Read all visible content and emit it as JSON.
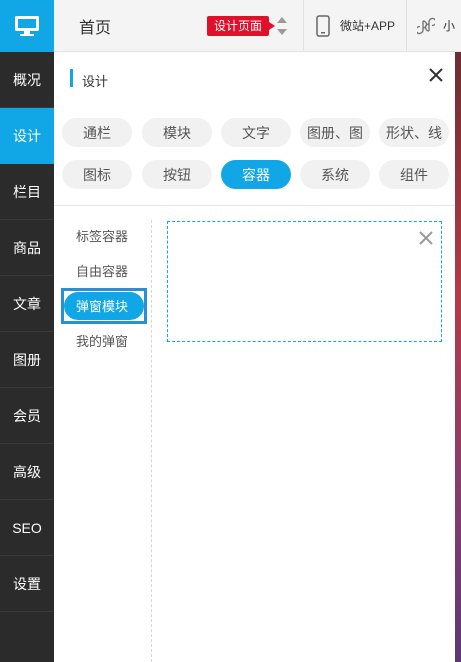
{
  "sidebar": {
    "logo_icon": "monitor-icon",
    "items": [
      {
        "label": "概况"
      },
      {
        "label": "设计",
        "active": true
      },
      {
        "label": "栏目"
      },
      {
        "label": "商品"
      },
      {
        "label": "文章"
      },
      {
        "label": "图册"
      },
      {
        "label": "会员"
      },
      {
        "label": "高级"
      },
      {
        "label": "SEO"
      },
      {
        "label": "设置"
      }
    ]
  },
  "topbar": {
    "home_label": "首页",
    "page_badge": "设计页面",
    "app_label": "微站+APP",
    "mini_label": "小",
    "icons": [
      "phone-icon",
      "mini-program-icon",
      "sort-arrows-icon"
    ]
  },
  "panel": {
    "title": "设计",
    "tabs": [
      "通栏",
      "模块",
      "文字",
      "图册、图",
      "形状、线",
      "图标",
      "按钮",
      "容器",
      "系统",
      "组件"
    ],
    "active_tab": "容器",
    "sub_items": [
      "标签容器",
      "自由容器",
      "弹窗模块",
      "我的弹窗"
    ],
    "active_sub_item": "弹窗模块"
  },
  "colors": {
    "accent": "#11a7e6",
    "sidebar_bg": "#2b2b2b",
    "badge_red": "#e0102a"
  }
}
